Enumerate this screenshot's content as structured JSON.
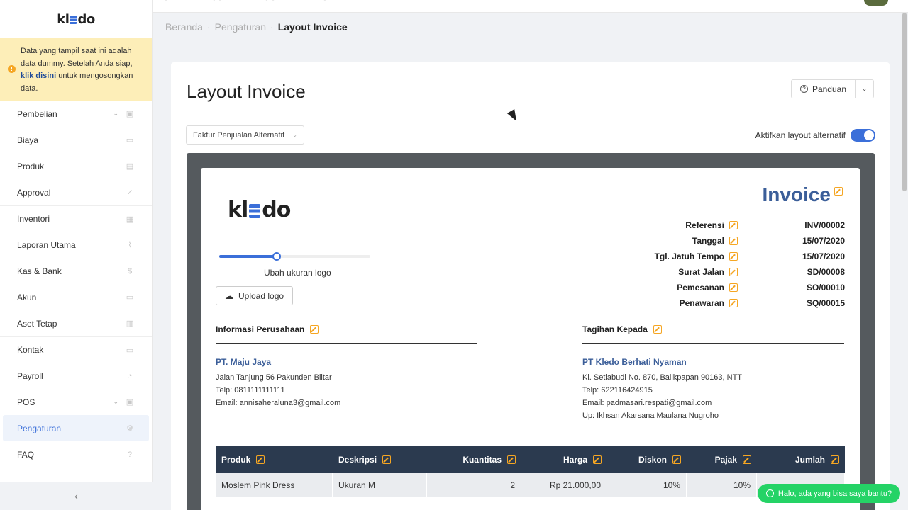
{
  "sidebar": {
    "logo": {
      "pre": "kl",
      "post": "do"
    },
    "notice": {
      "pre": "Data yang tampil saat ini adalah data dummy. Setelah Anda siap, ",
      "link": "klik disini",
      "post": " untuk mengosongkan data."
    },
    "items": [
      {
        "label": "Pembelian",
        "icon": "bag-icon",
        "glyph": "▣",
        "chevron": true
      },
      {
        "label": "Biaya",
        "icon": "money-icon",
        "glyph": "▭"
      },
      {
        "label": "Produk",
        "icon": "box-icon",
        "glyph": "▤"
      },
      {
        "label": "Approval",
        "icon": "check-icon",
        "glyph": "✓"
      },
      {
        "label": "Inventori",
        "icon": "briefcase-icon",
        "glyph": "▦"
      },
      {
        "label": "Laporan Utama",
        "icon": "chart-icon",
        "glyph": "⌇"
      },
      {
        "label": "Kas & Bank",
        "icon": "dollar-icon",
        "glyph": "$"
      },
      {
        "label": "Akun",
        "icon": "card-icon",
        "glyph": "▭"
      },
      {
        "label": "Aset Tetap",
        "icon": "building-icon",
        "glyph": "▥"
      },
      {
        "label": "Kontak",
        "icon": "contact-icon",
        "glyph": "▭"
      },
      {
        "label": "Payroll",
        "icon": "payroll-icon",
        "glyph": "◔"
      },
      {
        "label": "POS",
        "icon": "pos-icon",
        "glyph": "▣",
        "chevron": true
      },
      {
        "label": "Pengaturan",
        "icon": "gear-icon",
        "glyph": "⚙"
      },
      {
        "label": "FAQ",
        "icon": "question-icon",
        "glyph": "?"
      }
    ],
    "collapse": "‹"
  },
  "breadcrumb": {
    "home": "Beranda",
    "settings": "Pengaturan",
    "current": "Layout Invoice",
    "sep": "·"
  },
  "page": {
    "title": "Layout Invoice",
    "guide_label": "Panduan",
    "select_value": "Faktur Penjualan Alternatif",
    "toggle_label": "Aktifkan layout alternatif",
    "toggle_on": true
  },
  "invoice": {
    "title": "Invoice",
    "logo": {
      "pre": "kl",
      "post": "do"
    },
    "logo_size": 0.38,
    "slider_label": "Ubah ukuran logo",
    "upload_label": "Upload logo",
    "meta": [
      {
        "key": "Referensi",
        "value": "INV/00002"
      },
      {
        "key": "Tanggal",
        "value": "15/07/2020"
      },
      {
        "key": "Tgl. Jatuh Tempo",
        "value": "15/07/2020"
      },
      {
        "key": "Surat Jalan",
        "value": "SD/00008"
      },
      {
        "key": "Pemesanan",
        "value": "SO/00010"
      },
      {
        "key": "Penawaran",
        "value": "SQ/00015"
      }
    ],
    "company": {
      "heading": "Informasi Perusahaan",
      "name": "PT. Maju Jaya",
      "lines": [
        "Jalan Tanjung 56 Pakunden Blitar",
        "Telp: 0811111111111",
        "Email: annisaheraluna3@gmail.com"
      ]
    },
    "billing": {
      "heading": "Tagihan Kepada",
      "name": "PT Kledo Berhati Nyaman",
      "lines": [
        "Ki. Setiabudi No. 870, Balikpapan 90163, NTT",
        "Telp: 622116424915",
        "Email: padmasari.respati@gmail.com",
        "Up: Ikhsan Akarsana Maulana Nugroho"
      ]
    },
    "table": {
      "headers": [
        "Produk",
        "Deskripsi",
        "Kuantitas",
        "Harga",
        "Diskon",
        "Pajak",
        "Jumlah"
      ],
      "rows": [
        [
          "Moslem Pink Dress",
          "Ukuran M",
          "2",
          "Rp 21.000,00",
          "10%",
          "10%",
          ""
        ]
      ]
    }
  },
  "whatsapp": "Halo, ada yang bisa saya bantu?"
}
